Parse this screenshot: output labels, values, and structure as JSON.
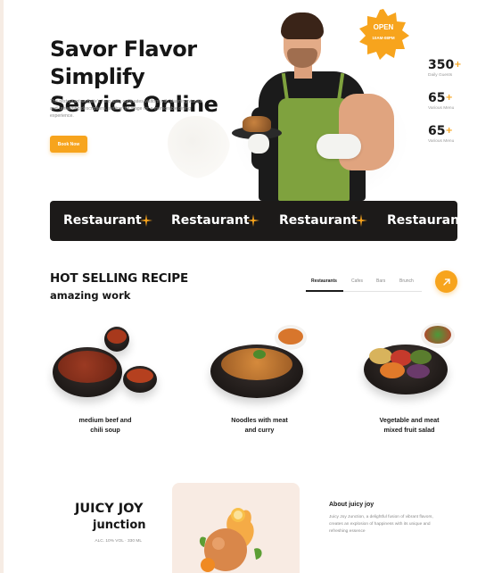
{
  "hero": {
    "title_line1": "Savor Flavor Simplify",
    "title_line2": "Service Online",
    "description": "The restaurant website's hero area captivates visitors with stunning visuals and tantalizing descriptions, setting the stage for a memorable dining experience.",
    "cta_label": "Book Now"
  },
  "badge": {
    "open_label": "OPEN",
    "hours": "10AM-08PM"
  },
  "stats": [
    {
      "value": "350",
      "suffix": "+",
      "label": "Daily Guests"
    },
    {
      "value": "65",
      "suffix": "+",
      "label": "Various Menu"
    },
    {
      "value": "65",
      "suffix": "+",
      "label": "Various Menu"
    }
  ],
  "banner": {
    "words": [
      "Restaurant",
      "Restaurant",
      "Restaurant",
      "Restaurant"
    ]
  },
  "recipes": {
    "title": "HOT SELLING RECIPE",
    "subtitle": "amazing work",
    "tabs": [
      "Restaurants",
      "Cafes",
      "Bars",
      "Brunch"
    ],
    "active_tab": "Restaurants",
    "dishes": [
      {
        "line1": "medium beef and",
        "line2": "chili soup"
      },
      {
        "line1": "Noodles with meat",
        "line2": "and curry"
      },
      {
        "line1": "Vegetable and meat",
        "line2": "mixed fruit salad"
      }
    ]
  },
  "juicy": {
    "title": "JUICY JOY",
    "subtitle": "junction",
    "meta": "ALC. 10% VOL · 330 ML",
    "about_title": "About juicy joy",
    "about_text": "Juicy Joy Junction, a delightful fusion of vibrant flavors, creates an explosion of happiness with its unique and refreshing essence"
  },
  "colors": {
    "accent": "#f7a41d",
    "dark": "#1c1a19",
    "apron": "#7fa23e",
    "juice_card": "#f8ebe3"
  }
}
